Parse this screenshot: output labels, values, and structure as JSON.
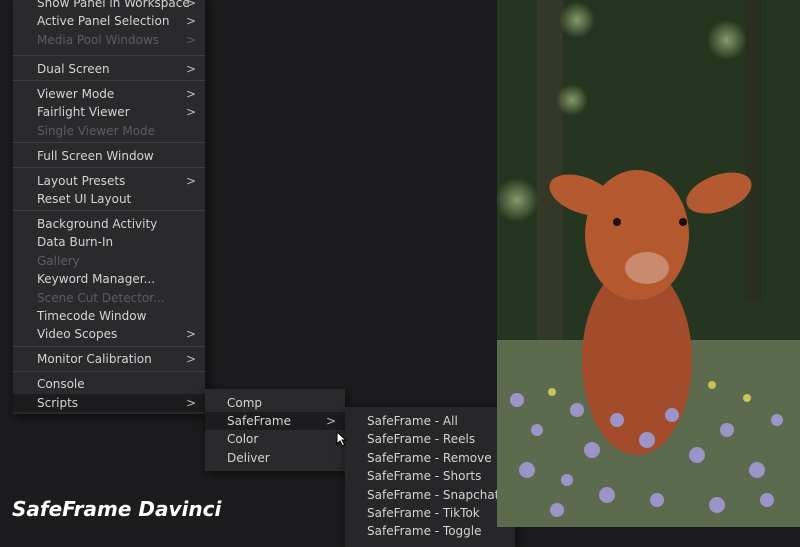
{
  "workspace_menu": {
    "items": [
      {
        "label": "Show Panel in Workspace",
        "submenu": true,
        "enabled": true
      },
      {
        "label": "Active Panel Selection",
        "submenu": true,
        "enabled": true
      },
      {
        "label": "Media Pool Windows",
        "submenu": true,
        "enabled": false
      },
      {
        "label": "Dual Screen",
        "submenu": true,
        "enabled": true
      },
      {
        "label": "Viewer Mode",
        "submenu": true,
        "enabled": true
      },
      {
        "label": "Fairlight Viewer",
        "submenu": true,
        "enabled": true
      },
      {
        "label": "Single Viewer Mode",
        "submenu": false,
        "enabled": false
      },
      {
        "label": "Full Screen Window",
        "submenu": false,
        "enabled": true
      },
      {
        "label": "Layout Presets",
        "submenu": true,
        "enabled": true
      },
      {
        "label": "Reset UI Layout",
        "submenu": false,
        "enabled": true
      },
      {
        "label": "Background Activity",
        "submenu": false,
        "enabled": true
      },
      {
        "label": "Data Burn-In",
        "submenu": false,
        "enabled": true
      },
      {
        "label": "Gallery",
        "submenu": false,
        "enabled": false
      },
      {
        "label": "Keyword Manager...",
        "submenu": false,
        "enabled": true
      },
      {
        "label": "Scene Cut Detector...",
        "submenu": false,
        "enabled": false
      },
      {
        "label": "Timecode Window",
        "submenu": false,
        "enabled": true
      },
      {
        "label": "Video Scopes",
        "submenu": true,
        "enabled": true
      },
      {
        "label": "Monitor Calibration",
        "submenu": true,
        "enabled": true
      },
      {
        "label": "Console",
        "submenu": false,
        "enabled": true
      },
      {
        "label": "Scripts",
        "submenu": true,
        "enabled": true,
        "highlighted": true
      }
    ]
  },
  "scripts_submenu": {
    "items": [
      {
        "label": "Comp"
      },
      {
        "label": "SafeFrame",
        "submenu": true,
        "highlighted": true
      },
      {
        "label": "Color"
      },
      {
        "label": "Deliver"
      }
    ]
  },
  "safeframe_submenu": {
    "items": [
      {
        "label": "SafeFrame - All"
      },
      {
        "label": "SafeFrame - Reels"
      },
      {
        "label": "SafeFrame - Remove"
      },
      {
        "label": "SafeFrame - Shorts"
      },
      {
        "label": "SafeFrame - Snapchat"
      },
      {
        "label": "SafeFrame - TikTok"
      },
      {
        "label": "SafeFrame - Toggle"
      }
    ]
  },
  "caption": "SafeFrame Davinci",
  "icons": {
    "chevron": "chevron-right-icon",
    "cursor": "mouse-pointer-icon"
  },
  "colors": {
    "menu_bg": "#2a2a2d",
    "highlight": "#1c1c1f",
    "text": "#d4d4d4",
    "disabled_text": "#5d5d60"
  }
}
